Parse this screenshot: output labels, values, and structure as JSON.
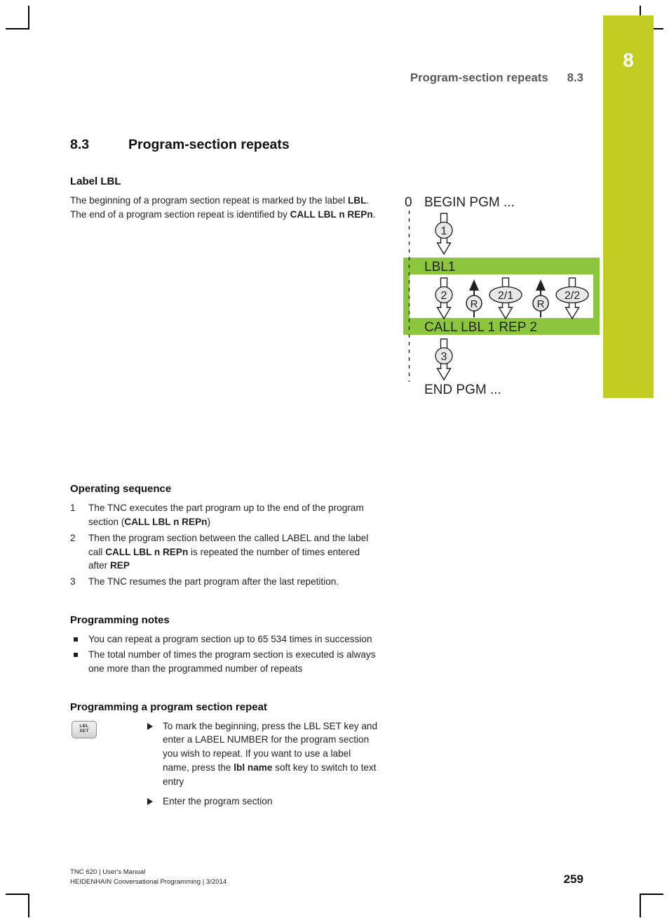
{
  "header": {
    "running_title": "Program-section repeats",
    "running_section": "8.3",
    "chapter_number": "8"
  },
  "section": {
    "number": "8.3",
    "title": "Program-section repeats"
  },
  "label_lbl": {
    "heading": "Label LBL",
    "paragraph_part1": "The beginning of a program section repeat is marked by the label ",
    "paragraph_bold1": "LBL",
    "paragraph_part2": ". The end of a program section repeat is identified by ",
    "paragraph_bold2": "CALL LBL n REPn",
    "paragraph_part3": "."
  },
  "operating_sequence": {
    "heading": "Operating sequence",
    "steps": [
      {
        "num": "1",
        "text_part1": "The TNC executes the part program up to the end of the program section (",
        "bold": "CALL LBL n REPn",
        "text_part2": ")"
      },
      {
        "num": "2",
        "text_part1": "Then the program section between the called LABEL and the label call ",
        "bold": "CALL LBL n REPn",
        "text_part2": " is repeated the number of times entered after ",
        "bold2": "REP"
      },
      {
        "num": "3",
        "text_part1": "The TNC resumes the part program after the last repetition.",
        "bold": "",
        "text_part2": ""
      }
    ]
  },
  "programming_notes": {
    "heading": "Programming notes",
    "items": [
      "You can repeat a program section up to 65 534 times in succession",
      "The total number of times the program section is executed is always one more than the programmed number of repeats"
    ]
  },
  "procedure": {
    "heading": "Programming a program section repeat",
    "key_icon": {
      "line1": "LBL",
      "line2": "SET"
    },
    "actions": [
      {
        "text_part1": "To mark the beginning, press the LBL SET key and enter a LABEL NUMBER for the program section you wish to repeat. If you want to use a label name, press the ",
        "bold": "lbl name",
        "text_part2": " soft key to switch to text entry"
      },
      {
        "text_part1": "Enter the program section",
        "bold": "",
        "text_part2": ""
      }
    ]
  },
  "diagram": {
    "accent_color": "#8cc63f",
    "begin_index": "0",
    "begin_label": "BEGIN PGM ...",
    "lbl_label": "LBL1",
    "call_label": "CALL LBL 1 REP 2",
    "end_label": "END PGM ...",
    "arrow_labels": {
      "step1": "1",
      "step2": "2",
      "rep1": "2/1",
      "rep2": "2/2",
      "return1": "R",
      "return2": "R",
      "step3": "3"
    }
  },
  "footer": {
    "line1": "TNC 620 | User's Manual",
    "line2": "HEIDENHAIN Conversational Programming | 3/2014",
    "page_number": "259"
  }
}
